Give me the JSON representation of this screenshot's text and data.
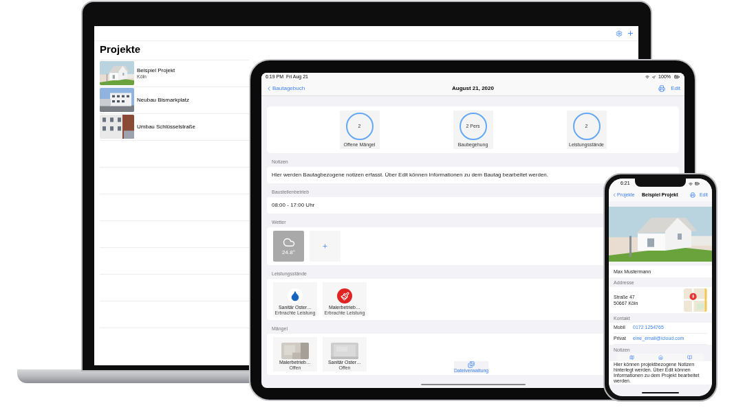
{
  "laptop": {
    "title": "Projekte",
    "projects": [
      {
        "name": "Beispiel Projekt",
        "subtitle": "Köln",
        "kind": "house"
      },
      {
        "name": "Neubau Bismarkplatz",
        "kind": "block"
      },
      {
        "name": "Umbau Schlüsselstraße",
        "kind": "facade"
      }
    ]
  },
  "tablet": {
    "status_bar": {
      "time": "6:19 PM",
      "date": "Fri Aug 21",
      "battery": "100%"
    },
    "nav": {
      "back": "Bautagebuch",
      "title": "August 21, 2020",
      "action": "Edit"
    },
    "summary": [
      {
        "value": "2",
        "label": "Offene Mängel"
      },
      {
        "value": "2 Pers",
        "label": "Baubegehung"
      },
      {
        "value": "2",
        "label": "Leistungsstände"
      }
    ],
    "sections": [
      {
        "kind": "text",
        "header": "Notizen",
        "text": "Hier werden Bautagbezogene notizen erfasst. Über Edit können Informationen zu dem Bautag bearbeitet werden."
      },
      {
        "kind": "text",
        "header": "Baustellenbetrieb",
        "text": "08:00 - 17:00 Uhr"
      },
      {
        "kind": "weather",
        "header": "Wetter",
        "temperature": "24.8°"
      },
      {
        "kind": "tiles",
        "header": "Leistungsstände",
        "items": [
          {
            "kind": "water",
            "title": "Sanitär Oster…",
            "subtitle": "Erbrachte Leistung"
          },
          {
            "kind": "painter",
            "title": "Malerbetrieb…",
            "subtitle": "Erbrachte Leistung"
          }
        ]
      },
      {
        "kind": "tiles",
        "header": "Mängel",
        "items": [
          {
            "title": "Malerbetrieb…",
            "subtitle": "Offen"
          },
          {
            "title": "Sanitär Oster…",
            "subtitle": "Offen"
          }
        ]
      }
    ],
    "tab": {
      "label": "Dateiverwaltung"
    }
  },
  "phone": {
    "status_bar": {
      "time": "6:21"
    },
    "nav": {
      "back": "Projekte",
      "title": "Beispiel Projekt",
      "action": "Edit"
    },
    "owner": "Max Mustermann",
    "address": {
      "header": "Addresse",
      "lines": [
        "Straße 47",
        "50667 Köln"
      ]
    },
    "contact": {
      "header": "Kontakt",
      "rows": [
        {
          "label": "Mobil",
          "value": "0172 1254765"
        },
        {
          "label": "Privat",
          "value": "eine_email@icloud.com"
        }
      ]
    },
    "notes": {
      "header": "Notizen",
      "text": "Hier können projektbezogene Notizen hinterlegt werden. Über Edit können Informationen zu dem Projekt bearbeitet werden."
    }
  }
}
